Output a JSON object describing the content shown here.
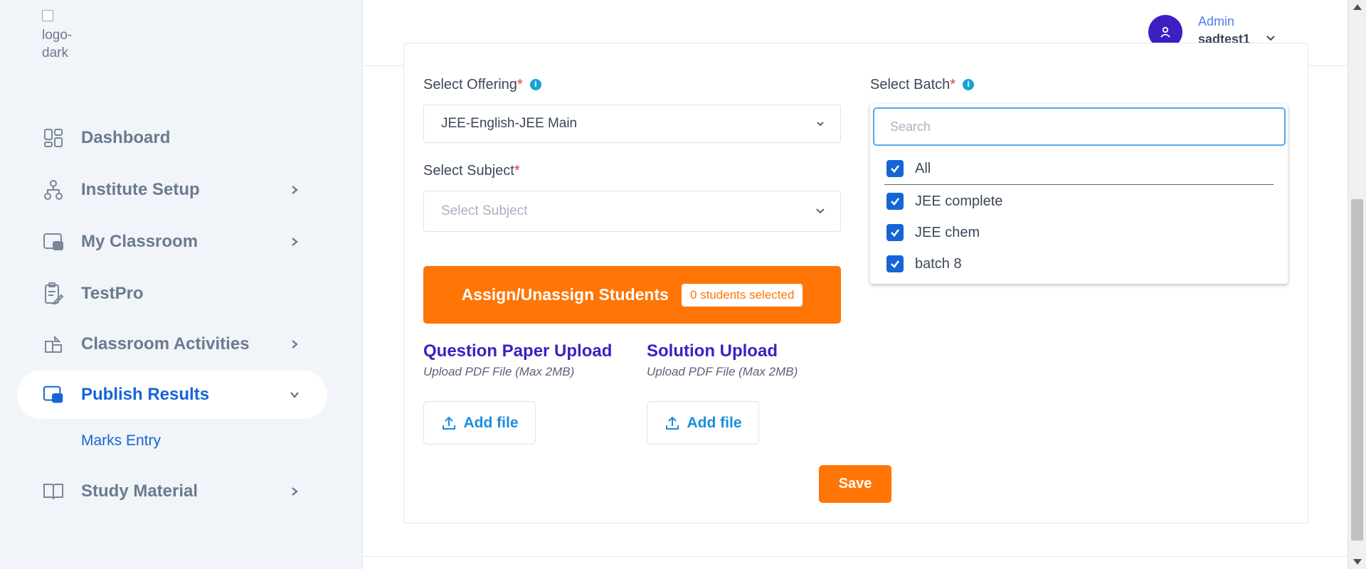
{
  "sidebar": {
    "logo_alt": "logo-dark",
    "items": [
      {
        "label": "Dashboard",
        "icon": "dashboard-icon"
      },
      {
        "label": "Institute Setup",
        "icon": "org-chart-icon"
      },
      {
        "label": "My Classroom",
        "icon": "classroom-icon"
      },
      {
        "label": "TestPro",
        "icon": "clipboard-edit-icon"
      },
      {
        "label": "Classroom Activities",
        "icon": "activities-icon"
      },
      {
        "label": "Publish Results",
        "icon": "publish-results-icon"
      },
      {
        "label": "Study Material",
        "icon": "book-open-icon"
      }
    ],
    "sub_item": "Marks Entry"
  },
  "header": {
    "role": "Admin",
    "username": "sadtest1"
  },
  "form": {
    "offering": {
      "label": "Select Offering",
      "value": "JEE-English-JEE Main"
    },
    "subject": {
      "label": "Select Subject",
      "placeholder": "Select Subject"
    },
    "batch": {
      "label": "Select Batch"
    },
    "required_mark": "*",
    "info_glyph": "i",
    "assign": {
      "label": "Assign/Unassign Students",
      "badge": "0 students selected"
    },
    "question_upload": {
      "title": "Question Paper Upload",
      "subtitle": "Upload PDF File (Max 2MB)",
      "button": "Add file"
    },
    "solution_upload": {
      "title": "Solution Upload",
      "subtitle": "Upload PDF File (Max 2MB)",
      "button": "Add file"
    },
    "save_label": "Save"
  },
  "batch_dropdown": {
    "search_placeholder": "Search",
    "options": [
      {
        "label": "All",
        "checked": true
      },
      {
        "label": "JEE complete",
        "checked": true
      },
      {
        "label": "JEE chem",
        "checked": true
      },
      {
        "label": "batch 8",
        "checked": true
      }
    ]
  },
  "colors": {
    "primary": "#1665d8",
    "accent_orange": "#ff7506",
    "heading_purple": "#3d1fc4",
    "sidebar_bg": "#f1f4f8"
  }
}
